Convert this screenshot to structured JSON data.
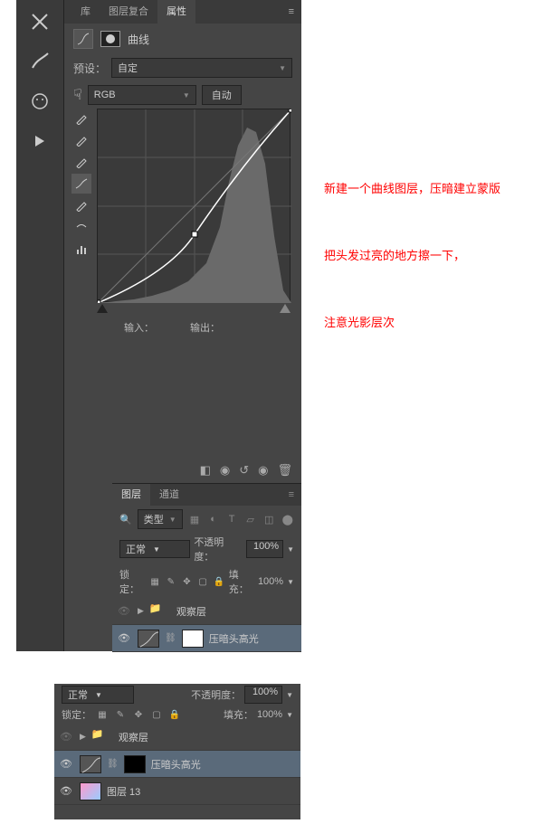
{
  "tabs": {
    "lib": "库",
    "layercomp": "图层复合",
    "props": "属性"
  },
  "curves_title": "曲线",
  "preset_lbl": "预设：",
  "preset_val": "自定",
  "channel_val": "RGB",
  "auto_btn": "自动",
  "io": {
    "in": "输入：",
    "out": "输出："
  },
  "layers": {
    "tab_layers": "图层",
    "tab_channels": "通道",
    "filter_kind": "类型",
    "blend": "正常",
    "opacity_lbl": "不透明度：",
    "opacity_val": "100%",
    "lock_lbl": "锁定：",
    "fill_lbl": "填充：",
    "fill_val": "100%",
    "group_name": "观察层",
    "curves_layer": "压暗头高光",
    "layer13": "图层 13"
  },
  "annotations": {
    "a1": "新建一个曲线图层，压暗建立蒙版",
    "a2": "把头发过亮的地方擦一下，",
    "a3": "注意光影层次"
  },
  "chart_data": {
    "type": "line",
    "title": "Curves (RGB)",
    "xlim": [
      0,
      255
    ],
    "ylim": [
      0,
      255
    ],
    "control_points": [
      {
        "x": 0,
        "y": 0
      },
      {
        "x": 128,
        "y": 90
      },
      {
        "x": 255,
        "y": 255
      }
    ],
    "histogram_peak_range": [
      150,
      220
    ]
  }
}
